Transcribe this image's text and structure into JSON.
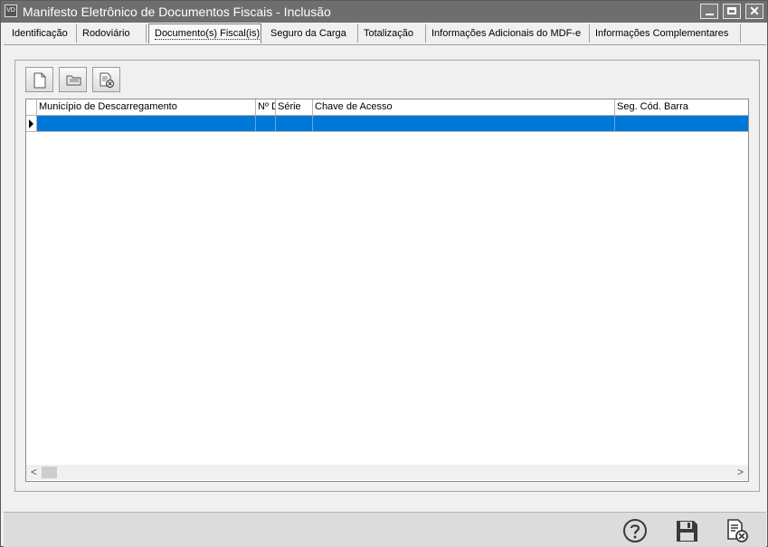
{
  "window": {
    "app_icon_text": "VD",
    "title": "Manifesto Eletrônico de Documentos Fiscais - Inclusão",
    "controls": {
      "minimize": "minimize",
      "maximize": "maximize",
      "close": "✕"
    }
  },
  "tabs": [
    {
      "label": "Identificação",
      "active": false
    },
    {
      "label": "Rodoviário",
      "active": false
    },
    {
      "label": "Documento(s) Fiscal(is)",
      "active": true
    },
    {
      "label": "Seguro da Carga",
      "active": false
    },
    {
      "label": "Totalização",
      "active": false
    },
    {
      "label": "Informações Adicionais do MDF-e",
      "active": false
    },
    {
      "label": "Informações Complementares",
      "active": false
    }
  ],
  "toolbar": {
    "icons": [
      "new-document-icon",
      "open-folder-icon",
      "delete-document-icon"
    ]
  },
  "grid": {
    "columns": [
      "Município de Descarregamento",
      "Nº D",
      "Série",
      "Chave de Acesso",
      "Seg. Cód. Barra"
    ],
    "rows": [
      [
        "",
        "",
        "",
        "",
        ""
      ]
    ],
    "selected_row_color": "#0078d7"
  },
  "scrollbar": {
    "left_arrow": "<",
    "right_arrow": ">"
  },
  "footer": {
    "icons": [
      "help-icon",
      "save-icon",
      "cancel-document-icon"
    ]
  }
}
